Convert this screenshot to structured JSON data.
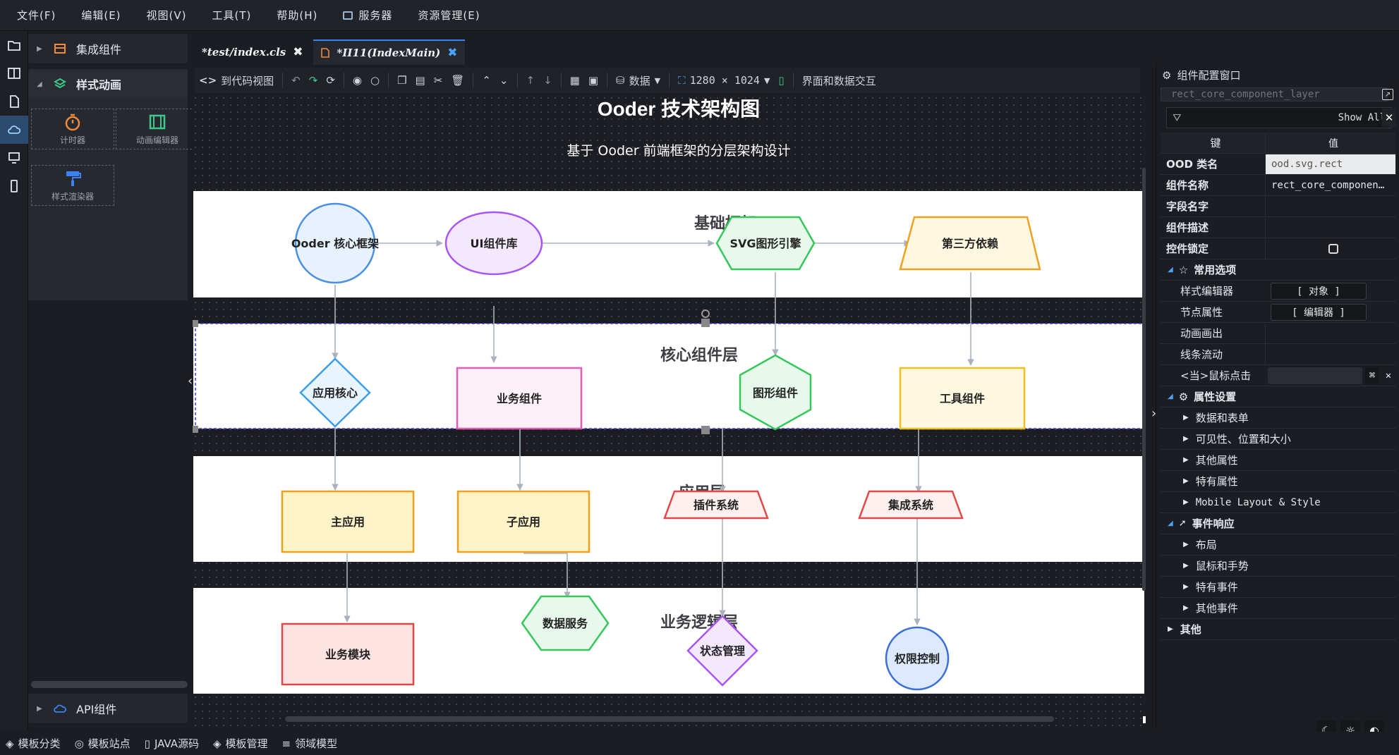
{
  "menubar": {
    "items": [
      "文件(F)",
      "编辑(E)",
      "视图(V)",
      "工具(T)",
      "帮助(H)",
      "服务器",
      "资源管理(E)"
    ]
  },
  "left_panel": {
    "sections": {
      "integration": "集成组件",
      "animation": "样式动画",
      "api": "API组件"
    },
    "tiles": {
      "timer": "计时器",
      "anim_editor": "动画编辑器",
      "style_renderer": "样式渲染器"
    }
  },
  "tabs": [
    {
      "label": "*test/index.cls",
      "active": false
    },
    {
      "label": "*II11(IndexMain)",
      "active": true
    }
  ],
  "toolbar": {
    "to_code_view": "到代码视图",
    "data_menu": "数据",
    "resolution": "1280 × 1024",
    "ui_data_interaction": "界面和数据交互"
  },
  "diagram": {
    "title": "Ooder 技术架构图",
    "subtitle": "基于 Ooder 前端框架的分层架构设计",
    "layers": {
      "base": "基础框架",
      "core": "核心组件层",
      "app": "应用层",
      "logic": "业务逻辑层"
    },
    "nodes": {
      "ooder_core": "Ooder 核心框架",
      "ui_lib": "UI组件库",
      "svg_engine": "SVG图形引擎",
      "third_party": "第三方依赖",
      "app_core": "应用核心",
      "biz_comp": "业务组件",
      "graph_comp": "图形组件",
      "tool_comp": "工具组件",
      "main_app": "主应用",
      "sub_app": "子应用",
      "plugin_sys": "插件系统",
      "integ_sys": "集成系统",
      "biz_module": "业务模块",
      "data_svc": "数据服务",
      "state_mgmt": "状态管理",
      "auth_ctrl": "权限控制"
    }
  },
  "right_panel": {
    "title": "组件配置窗口",
    "layer_input": "rect_core_component_layer",
    "filter_button": "Show All",
    "col_key": "键",
    "col_value": "值",
    "props": {
      "ood_class_label": "OOD 类名",
      "ood_class_value": "ood.svg.rect",
      "comp_name_label": "组件名称",
      "comp_name_value": "rect_core_componen…",
      "field_name_label": "字段名字",
      "comp_desc_label": "组件描述",
      "lock_label": "控件锁定"
    },
    "common": {
      "title": "常用选项",
      "style_editor": "样式编辑器",
      "style_editor_btn": "[ 对象 ]",
      "node_props": "节点属性",
      "node_props_btn": "[ 编辑器 ]",
      "anim_draw": "动画画出",
      "line_flow": "线条流动",
      "mouse_click": "<当>鼠标点击"
    },
    "attrs": {
      "title": "属性设置",
      "items": [
        "数据和表单",
        "可见性、位置和大小",
        "其他属性",
        "特有属性",
        "Mobile Layout & Style"
      ]
    },
    "events": {
      "title": "事件响应",
      "items": [
        "布局",
        "鼠标和手势",
        "特有事件",
        "其他事件"
      ]
    },
    "other": "其他"
  },
  "statusbar": {
    "items": [
      "模板分类",
      "模板站点",
      "JAVA源码",
      "模板管理",
      "领域模型"
    ]
  }
}
